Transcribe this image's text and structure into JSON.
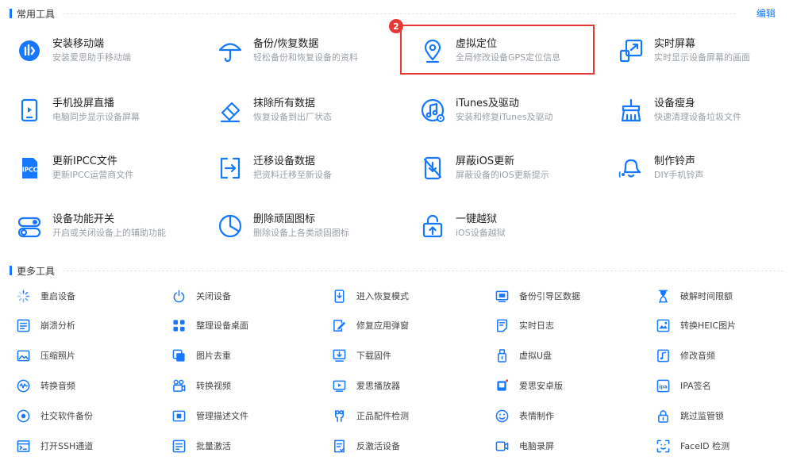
{
  "colors": {
    "accent": "#1677ff",
    "highlight": "#e53935"
  },
  "common": {
    "title": "常用工具",
    "edit_label": "编辑",
    "badge": "2",
    "tools": [
      {
        "title": "安装移动端",
        "desc": "安装爱思助手移动端",
        "icon": "install-mobile-icon"
      },
      {
        "title": "备份/恢复数据",
        "desc": "轻松备份和恢复设备的资料",
        "icon": "umbrella-icon"
      },
      {
        "title": "虚拟定位",
        "desc": "全局修改设备GPS定位信息",
        "icon": "location-pin-icon"
      },
      {
        "title": "实时屏幕",
        "desc": "实时显示设备屏幕的画面",
        "icon": "screen-mirror-icon"
      },
      {
        "title": "手机投屏直播",
        "desc": "电脑同步显示设备屏幕",
        "icon": "phone-cast-icon"
      },
      {
        "title": "抹除所有数据",
        "desc": "恢复设备到出厂状态",
        "icon": "eraser-icon"
      },
      {
        "title": "iTunes及驱动",
        "desc": "安装和修复iTunes及驱动",
        "icon": "music-note-icon"
      },
      {
        "title": "设备瘦身",
        "desc": "快速清理设备垃圾文件",
        "icon": "broom-icon"
      },
      {
        "title": "更新IPCC文件",
        "desc": "更新IPCC运营商文件",
        "icon": "ipcc-file-icon"
      },
      {
        "title": "迁移设备数据",
        "desc": "把资料迁移至新设备",
        "icon": "transfer-icon"
      },
      {
        "title": "屏蔽iOS更新",
        "desc": "屏蔽设备的iOS更新提示",
        "icon": "block-update-icon"
      },
      {
        "title": "制作铃声",
        "desc": "DIY手机铃声",
        "icon": "bell-icon"
      },
      {
        "title": "设备功能开关",
        "desc": "开启或关闭设备上的辅助功能",
        "icon": "toggle-icon"
      },
      {
        "title": "删除顽固图标",
        "desc": "删除设备上各类顽固图标",
        "icon": "pie-clock-icon"
      },
      {
        "title": "一键越狱",
        "desc": "iOS设备越狱",
        "icon": "unlock-upload-icon"
      }
    ]
  },
  "more": {
    "title": "更多工具",
    "tools": [
      {
        "label": "重启设备",
        "icon": "restart-spinner-icon"
      },
      {
        "label": "关闭设备",
        "icon": "power-icon"
      },
      {
        "label": "进入恢复模式",
        "icon": "recovery-mode-icon"
      },
      {
        "label": "备份引导区数据",
        "icon": "backup-boot-icon"
      },
      {
        "label": "破解时间限额",
        "icon": "hourglass-icon"
      },
      {
        "label": "崩溃分析",
        "icon": "crash-analysis-icon"
      },
      {
        "label": "整理设备桌面",
        "icon": "desktop-grid-icon"
      },
      {
        "label": "修复应用弹窗",
        "icon": "fix-popup-icon"
      },
      {
        "label": "实时日志",
        "icon": "realtime-log-icon"
      },
      {
        "label": "转换HEIC图片",
        "icon": "heic-convert-icon"
      },
      {
        "label": "压缩照片",
        "icon": "compress-photo-icon"
      },
      {
        "label": "图片去重",
        "icon": "image-dedupe-icon"
      },
      {
        "label": "下载固件",
        "icon": "download-firmware-icon"
      },
      {
        "label": "虚拟U盘",
        "icon": "virtual-usb-icon"
      },
      {
        "label": "修改音频",
        "icon": "edit-audio-icon"
      },
      {
        "label": "转换音频",
        "icon": "convert-audio-icon"
      },
      {
        "label": "转换视频",
        "icon": "convert-video-icon"
      },
      {
        "label": "爱思播放器",
        "icon": "player-icon"
      },
      {
        "label": "爱思安卓版",
        "icon": "android-app-icon"
      },
      {
        "label": "IPA签名",
        "icon": "ipa-sign-icon"
      },
      {
        "label": "社交软件备份",
        "icon": "social-backup-icon"
      },
      {
        "label": "管理描述文件",
        "icon": "profile-manage-icon"
      },
      {
        "label": "正品配件检测",
        "icon": "accessory-check-icon"
      },
      {
        "label": "表情制作",
        "icon": "emoji-icon"
      },
      {
        "label": "跳过监管锁",
        "icon": "skip-lock-icon"
      },
      {
        "label": "打开SSH通道",
        "icon": "ssh-terminal-icon"
      },
      {
        "label": "批量激活",
        "icon": "batch-activate-icon"
      },
      {
        "label": "反激活设备",
        "icon": "deactivate-icon"
      },
      {
        "label": "电脑录屏",
        "icon": "screen-record-icon"
      },
      {
        "label": "FaceID 检测",
        "icon": "faceid-icon"
      }
    ]
  }
}
